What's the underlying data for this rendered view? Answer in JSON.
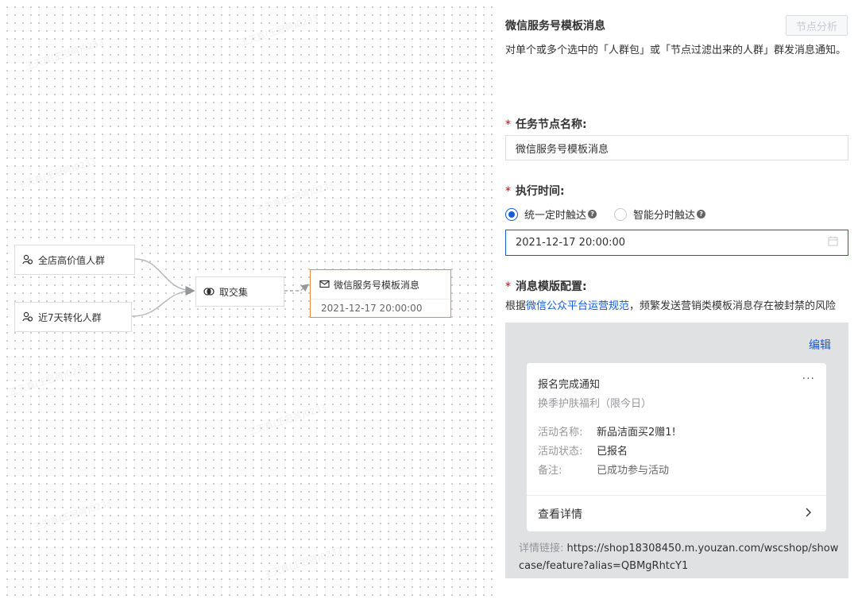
{
  "canvas": {
    "nodes": {
      "source_1": {
        "label": "全店高价值人群",
        "icon": "crowd-icon"
      },
      "source_2": {
        "label": "近7天转化人群",
        "icon": "crowd-icon"
      },
      "operator": {
        "label": "取交集",
        "icon": "intersection-icon"
      },
      "message": {
        "label": "微信服务号模板消息",
        "time": "2021-12-17 20:00:00",
        "icon": "mail-icon"
      }
    },
    "watermark": "王天真(王冠荷)0233"
  },
  "panel": {
    "title": "微信服务号模板消息",
    "analysis_button": "节点分析",
    "description": "对单个或多个选中的「人群包」或「节点过滤出来的人群」群发消息通知。",
    "task_name": {
      "label": "任务节点名称:",
      "value": "微信服务号模板消息"
    },
    "exec_time": {
      "label": "执行时间:",
      "options": [
        {
          "label": "统一定时触达",
          "selected": true
        },
        {
          "label": "智能分时触达",
          "selected": false
        }
      ],
      "value": "2021-12-17 20:00:00",
      "icon": "calendar-icon"
    },
    "template": {
      "label": "消息模版配置:",
      "notice_prefix": "根据",
      "notice_link": "微信公众平台运营规范",
      "notice_suffix": "，频繁发送营销类模板消息存在被封禁的风险",
      "edit_label": "编辑",
      "card": {
        "title": "报名完成通知",
        "more": "···",
        "subtitle": "换季护肤福利（限今日）",
        "rows": [
          {
            "key": "活动名称:",
            "value": "新品洁面买2赠1!"
          },
          {
            "key": "活动状态:",
            "value": "已报名"
          },
          {
            "key": "备注:",
            "value": "已成功参与活动"
          }
        ],
        "detail_label": "查看详情"
      },
      "link_key": "详情链接:",
      "link_value": "https://shop18308450.m.youzan.com/wscshop/showcase/feature?alias=QBMgRhtcY1"
    }
  },
  "colors": {
    "primary": "#155bd4",
    "selected_node_border": "#ed8a3d",
    "required": "#d40000"
  }
}
